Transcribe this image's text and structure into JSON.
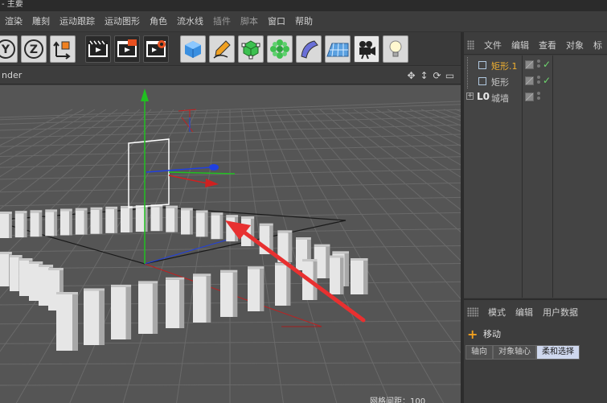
{
  "window": {
    "title": "- 主要"
  },
  "menubar": {
    "items": [
      {
        "label": "渲染",
        "dim": false
      },
      {
        "label": "雕刻",
        "dim": false
      },
      {
        "label": "运动跟踪",
        "dim": false
      },
      {
        "label": "运动图形",
        "dim": false
      },
      {
        "label": "角色",
        "dim": false
      },
      {
        "label": "流水线",
        "dim": false
      },
      {
        "label": "插件",
        "dim": true
      },
      {
        "label": "脚本",
        "dim": true
      },
      {
        "label": "窗口",
        "dim": false
      },
      {
        "label": "帮助",
        "dim": false
      }
    ]
  },
  "toolbar": {
    "axis_y": "Y",
    "axis_z": "Z",
    "icons": [
      "axis-y-icon",
      "axis-z-icon",
      "coordinate-system-icon",
      "render-view-icon",
      "render-picture-viewer-icon",
      "render-settings-icon",
      "cube-icon",
      "pen-icon",
      "subdivision-icon",
      "mograph-cloner-icon",
      "deformer-icon",
      "floor-icon",
      "camera-icon",
      "light-icon"
    ]
  },
  "viewport": {
    "label": "nder",
    "hud_text": "网格间距：100"
  },
  "object_manager": {
    "menu": [
      "文件",
      "编辑",
      "查看",
      "对象",
      "标"
    ],
    "objects": [
      {
        "name": "矩形.1",
        "active": true,
        "type": "spline",
        "checked": true
      },
      {
        "name": "矩形",
        "active": false,
        "type": "spline",
        "checked": true
      },
      {
        "name": "城墙",
        "active": false,
        "type": "null",
        "checked": false
      }
    ]
  },
  "attribute_manager": {
    "menu": [
      "模式",
      "编辑",
      "用户数据"
    ],
    "tool_title": "移动",
    "tabs": [
      {
        "label": "轴向",
        "active": false
      },
      {
        "label": "对象轴心",
        "active": false
      },
      {
        "label": "柔和选择",
        "active": true
      }
    ]
  },
  "colors": {
    "viewport_bg": "#555555",
    "grid": "#6a6a6a",
    "axis_y": "#21c021",
    "axis_x": "#d02020",
    "axis_z": "#2040e0",
    "annotation_arrow": "#e83030",
    "active_object": "#f0b030"
  }
}
